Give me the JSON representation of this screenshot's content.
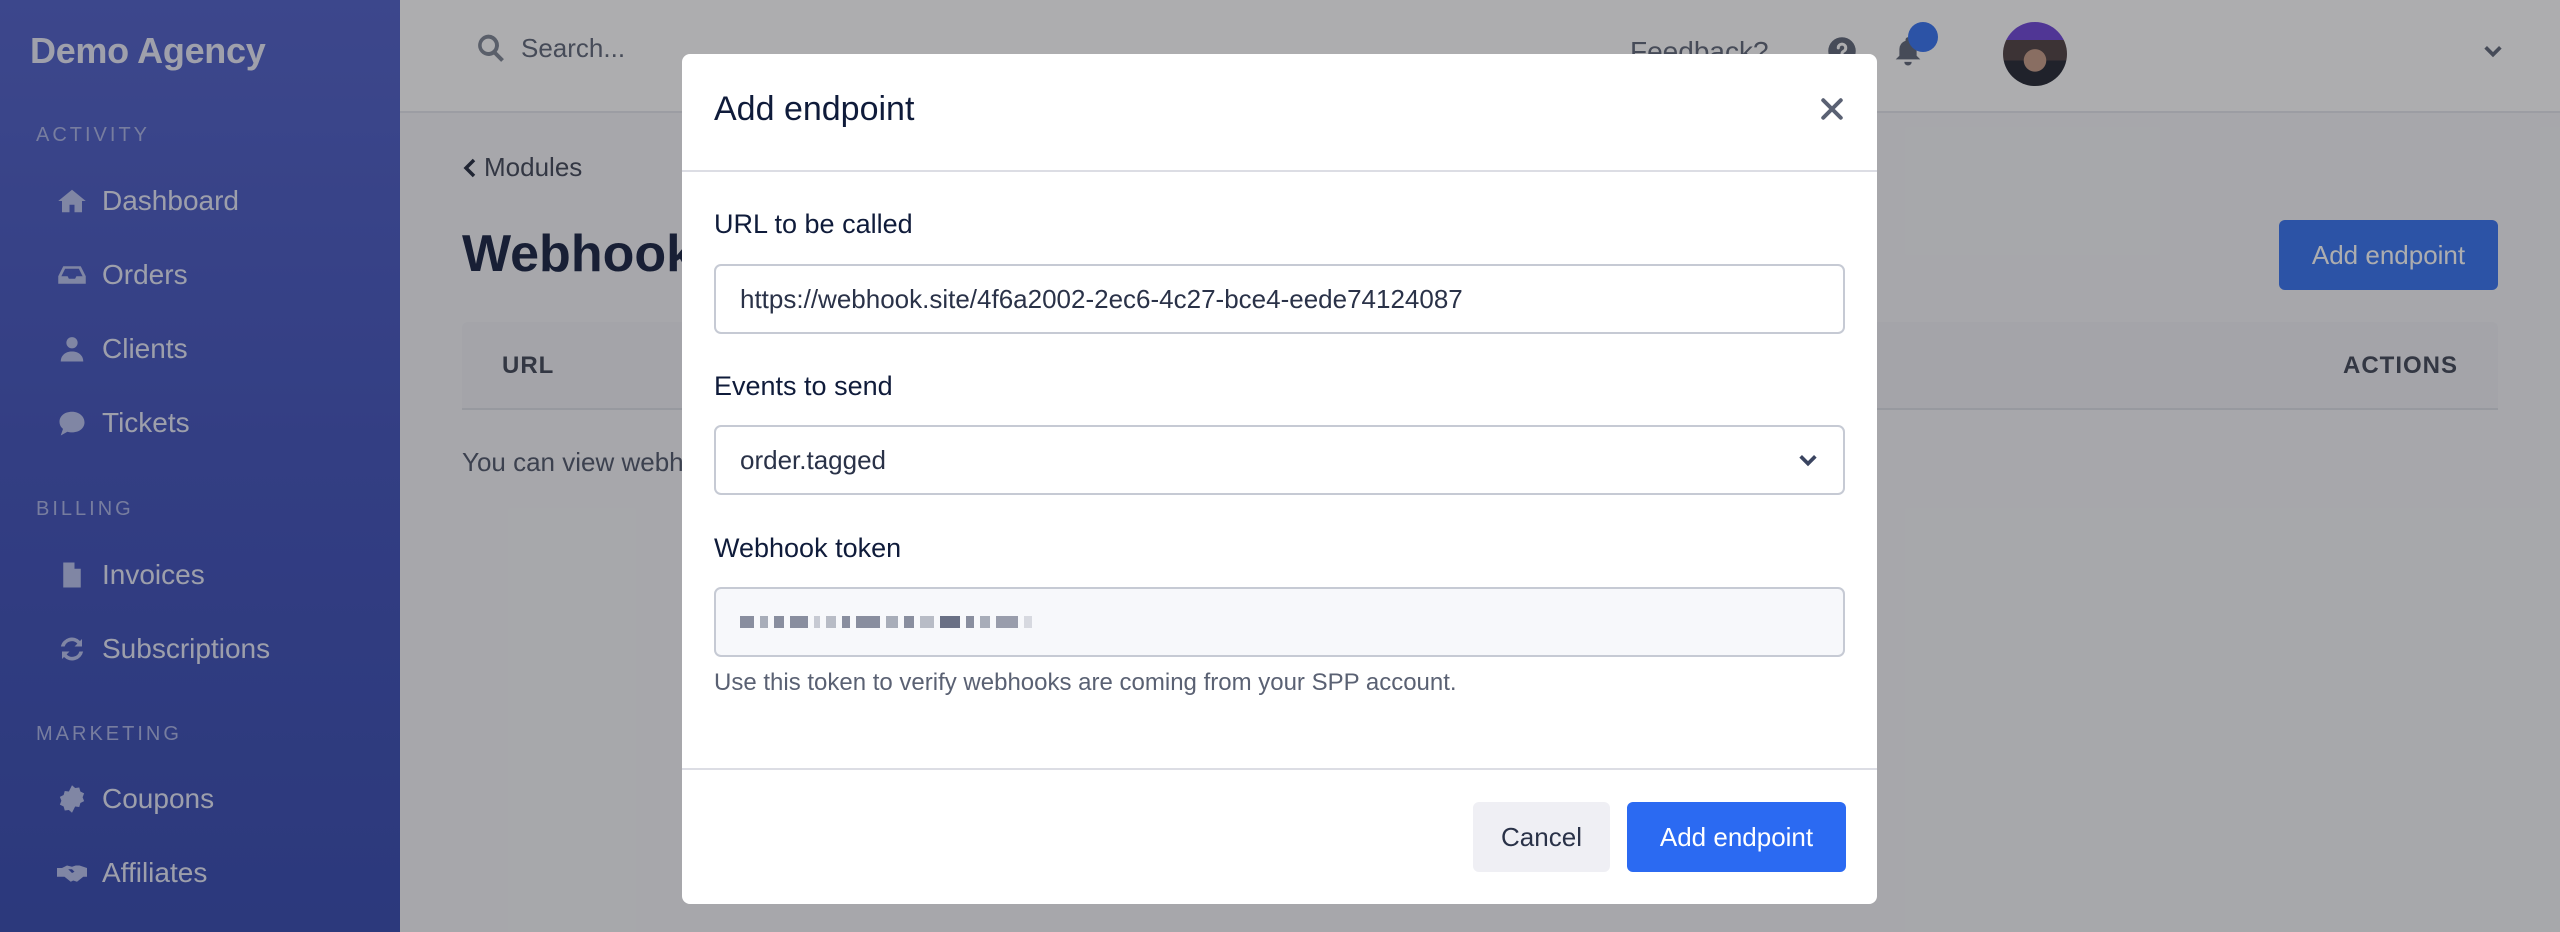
{
  "sidebar": {
    "brand": "Demo Agency",
    "sections": [
      {
        "label": "ACTIVITY",
        "items": [
          {
            "label": "Dashboard",
            "icon": "home-icon"
          },
          {
            "label": "Orders",
            "icon": "inbox-icon"
          },
          {
            "label": "Clients",
            "icon": "user-icon"
          },
          {
            "label": "Tickets",
            "icon": "comment-icon"
          }
        ]
      },
      {
        "label": "BILLING",
        "items": [
          {
            "label": "Invoices",
            "icon": "file-icon"
          },
          {
            "label": "Subscriptions",
            "icon": "sync-icon"
          }
        ]
      },
      {
        "label": "MARKETING",
        "items": [
          {
            "label": "Coupons",
            "icon": "percent-badge-icon"
          },
          {
            "label": "Affiliates",
            "icon": "handshake-icon"
          }
        ]
      }
    ]
  },
  "topbar": {
    "search_placeholder": "Search...",
    "feedback": "Feedback?",
    "help_icon": "question-circle-icon",
    "bell_icon": "bell-icon",
    "notification_dot_color": "#2f6ef0"
  },
  "main": {
    "back_link": "Modules",
    "title": "Webhooks",
    "add_button": "Add endpoint",
    "table": {
      "columns": [
        "URL",
        "ACTIONS"
      ]
    },
    "empty_text_visible": "You can view webh"
  },
  "modal": {
    "title": "Add endpoint",
    "url_label": "URL to be called",
    "url_value": "https://webhook.site/4f6a2002-2ec6-4c27-bce4-eede74124087",
    "events_label": "Events to send",
    "events_value": "order.tagged",
    "token_label": "Webhook token",
    "token_value_redacted": true,
    "token_help": "Use this token to verify webhooks are coming from your SPP account.",
    "cancel": "Cancel",
    "submit": "Add endpoint"
  },
  "colors": {
    "accent": "#2b6af2",
    "sidebar": "#3a4cb8",
    "title": "#0f1b3a"
  }
}
